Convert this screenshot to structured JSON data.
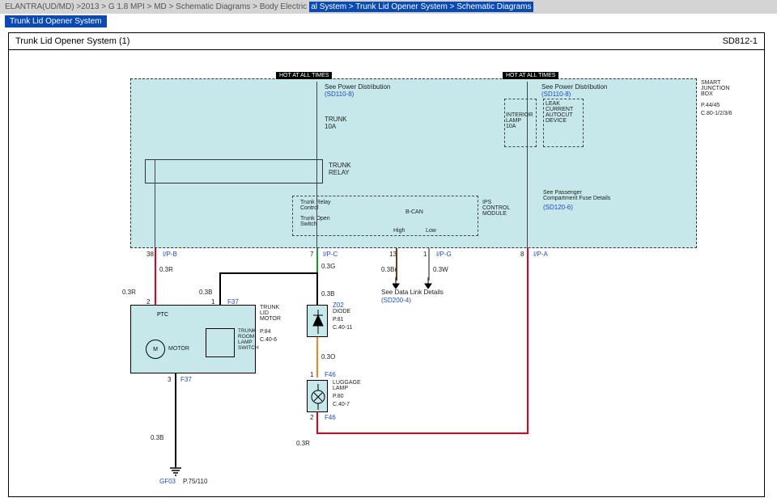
{
  "breadcrumb": {
    "p1": "ELANTRA(UD/MD) >2013 > G 1.8 MPI > MD > Schematic Diagrams > Body Electric",
    "p2": "al System > Trunk Lid Opener System > Schematic Diagrams"
  },
  "subTitle": "Trunk Lid Opener System",
  "titleLeft": "Trunk Lid Opener System (1)",
  "titleRight": "SD812-1",
  "labels": {
    "hot1": "HOT AT ALL TIMES",
    "hot2": "HOT AT ALL TIMES",
    "seePower1": "See Power Distribution",
    "sd1108a": "(SD110-8)",
    "seePower2": "See Power Distribution",
    "sd1108b": "(SD110-8)",
    "trunk10a": "TRUNK\n10A",
    "interior10a": "INTERIOR\nLAMP\n10A",
    "leakCurrent": "LEAK\nCURRENT\nAUTOCUT\nDEVICE",
    "smartJunction": "SMART\nJUNCTION\nBOX",
    "p4445": "P.44/45",
    "c80": "C.80-1/2/3/6",
    "trunkRelay": "TRUNK\nRELAY",
    "trunkRelayControl": "Trunk Relay\nControl",
    "trunkOpenSwitch": "Trunk Open\nSwitch",
    "ipsControl": "IPS\nCONTROL\nMODULE",
    "bcan": "B-CAN",
    "high": "High",
    "low": "Low",
    "seePassenger": "See Passenger\nCompartment Fuse Details",
    "sd1206": "(SD120-6)",
    "pin38": "38",
    "ipb": "I/P-B",
    "pin7": "7",
    "ipc": "I/P-C",
    "pin13": "13",
    "pin1": "1",
    "ipg": "I/P-G",
    "pin8": "8",
    "ipa": "I/P-A",
    "w03r": "0.3R",
    "w03g": "0.3G",
    "w03br": "0.3Br",
    "w03w": "0.3W",
    "w03b": "0.3B",
    "w03o": "0.3O",
    "sd2004": "See Data Link Details",
    "sd2004b": "(SD200-4)",
    "pin2": "2",
    "pin1b": "1",
    "f37": "F37",
    "trunkLidMotor": "TRUNK\nLID\nMOTOR",
    "p84": "P.84",
    "c406": "C.40-6",
    "ptc": "PTC",
    "motor": "MOTOR",
    "trunkRoomLamp": "TRUNK\nROOM\nLAMP\nSWITCH",
    "pin3": "3",
    "z02": "Z02",
    "diode": "DIODE",
    "p81": "P.81",
    "c4011": "C.40-11",
    "f46": "F46",
    "luggageLamp": "LUGGAGE\nLAMP",
    "p80": "P.80",
    "c407": "C.40-7",
    "gf03": "GF03",
    "p75110": "P.75/110"
  }
}
